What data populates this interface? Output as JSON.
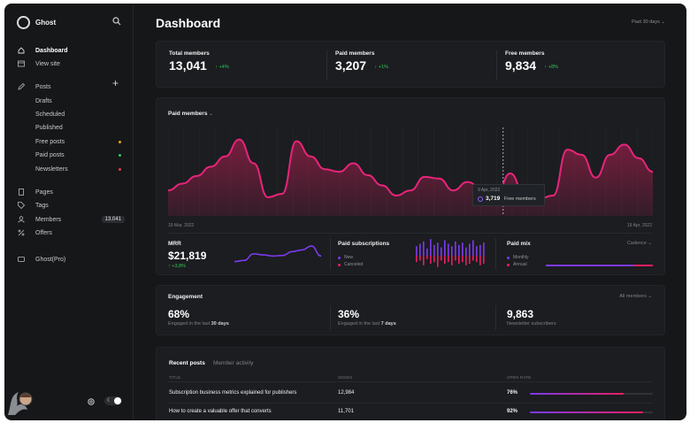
{
  "sidebar": {
    "brand": "Ghost",
    "nav": [
      {
        "label": "Dashboard",
        "icon": "home-icon"
      },
      {
        "label": "View site",
        "icon": "window-icon"
      }
    ],
    "posts_label": "Posts",
    "post_sub": [
      {
        "label": "Drafts"
      },
      {
        "label": "Scheduled"
      },
      {
        "label": "Published"
      },
      {
        "label": "Free posts",
        "dot_color": "#f0a020"
      },
      {
        "label": "Paid posts",
        "dot_color": "#34c759"
      },
      {
        "label": "Newsletters",
        "dot_color": "#e53950"
      }
    ],
    "bottom_nav": [
      {
        "label": "Pages",
        "icon": "pages-icon"
      },
      {
        "label": "Tags",
        "icon": "tag-icon"
      },
      {
        "label": "Members",
        "icon": "members-icon",
        "count": "13,041"
      },
      {
        "label": "Offers",
        "icon": "percent-icon"
      }
    ],
    "ghost_pro": "Ghost(Pro)"
  },
  "header": {
    "title": "Dashboard",
    "range": "Past 30 days"
  },
  "kpis": [
    {
      "label": "Total members",
      "value": "13,041",
      "delta": "+4%"
    },
    {
      "label": "Paid members",
      "value": "3,207",
      "delta": "+1%"
    },
    {
      "label": "Free members",
      "value": "9,834",
      "delta": "+8%"
    }
  ],
  "chart": {
    "title": "Paid members",
    "start_date": "19 Mar, 2022",
    "end_date": "19 Apr, 2022",
    "tooltip": {
      "date": "9 Apr, 2022",
      "value": "3,719",
      "label": "Free members"
    }
  },
  "chart_data": {
    "type": "area",
    "ylim": [
      0,
      100
    ],
    "values": [
      30,
      38,
      47,
      58,
      70,
      90,
      62,
      22,
      26,
      88,
      70,
      55,
      52,
      62,
      48,
      36,
      24,
      30,
      46,
      44,
      30,
      40,
      32,
      24,
      50,
      26,
      20,
      24,
      78,
      72,
      45,
      72,
      84,
      68,
      52
    ]
  },
  "mrr": {
    "label": "MRR",
    "value": "$21,819",
    "delta": "+3,8%"
  },
  "mrr_line": [
    12,
    14,
    26,
    24,
    22,
    23,
    30,
    33,
    40,
    22
  ],
  "paid_subs": {
    "label": "Paid subscriptions",
    "legend": [
      {
        "label": "New",
        "color": "#7c3aed"
      },
      {
        "label": "Canceled",
        "color": "#e91e63"
      }
    ],
    "new_bars": [
      8,
      10,
      12,
      6,
      14,
      9,
      11,
      7,
      13,
      10,
      8,
      12,
      9,
      11,
      7,
      10,
      13,
      8,
      9,
      11
    ],
    "cancel_bars": [
      4,
      3,
      6,
      2,
      5,
      4,
      7,
      3,
      5,
      4,
      6,
      3,
      5,
      4,
      6,
      5,
      3,
      4,
      6,
      5
    ]
  },
  "paid_mix": {
    "label": "Paid mix",
    "selector": "Cadence",
    "legend": [
      {
        "label": "Monthly",
        "color": "#7c3aed"
      },
      {
        "label": "Annual",
        "color": "#e91e63"
      }
    ],
    "monthly_share": 0.82
  },
  "engagement": {
    "title": "Engagement",
    "selector": "All members",
    "stats": [
      {
        "value": "68%",
        "caption": "Engaged in the last",
        "emph": "30 days"
      },
      {
        "value": "36%",
        "caption": "Engaged in the last",
        "emph": "7 days"
      },
      {
        "value": "9,863",
        "caption": "Newsletter subscribers",
        "emph": ""
      }
    ]
  },
  "recent": {
    "tabs": [
      "Recent posts",
      "Member activity"
    ],
    "headers": [
      "TITLE",
      "SENDS",
      "OPEN RATE"
    ],
    "rows": [
      {
        "title": "Subscription business metrics explained for publishers",
        "sends": "12,984",
        "rate": "76%",
        "rate_value": 0.76
      },
      {
        "title": "How to create a valuable offer that converts",
        "sends": "11,701",
        "rate": "92%",
        "rate_value": 0.92
      }
    ]
  },
  "colors": {
    "accent_pink": "#e91e63",
    "accent_purple": "#7c3aed",
    "positive": "#34c759"
  }
}
